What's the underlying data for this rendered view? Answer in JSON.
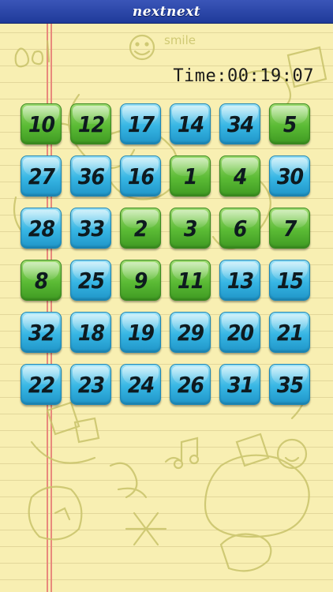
{
  "app": {
    "title": "nextnext"
  },
  "timer": {
    "text": "Time:00:19:07"
  },
  "doodle_text": "smile",
  "colors": {
    "blue_tile": "#37b6e4",
    "green_tile": "#5bbb35",
    "titlebar": "#2a46a8",
    "paper": "#f8efb2"
  },
  "tiles": [
    {
      "num": "10",
      "state": "green"
    },
    {
      "num": "12",
      "state": "green"
    },
    {
      "num": "17",
      "state": "blue"
    },
    {
      "num": "14",
      "state": "blue"
    },
    {
      "num": "34",
      "state": "blue"
    },
    {
      "num": "5",
      "state": "green"
    },
    {
      "num": "27",
      "state": "blue"
    },
    {
      "num": "36",
      "state": "blue"
    },
    {
      "num": "16",
      "state": "blue"
    },
    {
      "num": "1",
      "state": "green"
    },
    {
      "num": "4",
      "state": "green"
    },
    {
      "num": "30",
      "state": "blue"
    },
    {
      "num": "28",
      "state": "blue"
    },
    {
      "num": "33",
      "state": "blue"
    },
    {
      "num": "2",
      "state": "green"
    },
    {
      "num": "3",
      "state": "green"
    },
    {
      "num": "6",
      "state": "green"
    },
    {
      "num": "7",
      "state": "green"
    },
    {
      "num": "8",
      "state": "green"
    },
    {
      "num": "25",
      "state": "blue"
    },
    {
      "num": "9",
      "state": "green"
    },
    {
      "num": "11",
      "state": "green"
    },
    {
      "num": "13",
      "state": "blue"
    },
    {
      "num": "15",
      "state": "blue"
    },
    {
      "num": "32",
      "state": "blue"
    },
    {
      "num": "18",
      "state": "blue"
    },
    {
      "num": "19",
      "state": "blue"
    },
    {
      "num": "29",
      "state": "blue"
    },
    {
      "num": "20",
      "state": "blue"
    },
    {
      "num": "21",
      "state": "blue"
    },
    {
      "num": "22",
      "state": "blue"
    },
    {
      "num": "23",
      "state": "blue"
    },
    {
      "num": "24",
      "state": "blue"
    },
    {
      "num": "26",
      "state": "blue"
    },
    {
      "num": "31",
      "state": "blue"
    },
    {
      "num": "35",
      "state": "blue"
    }
  ]
}
